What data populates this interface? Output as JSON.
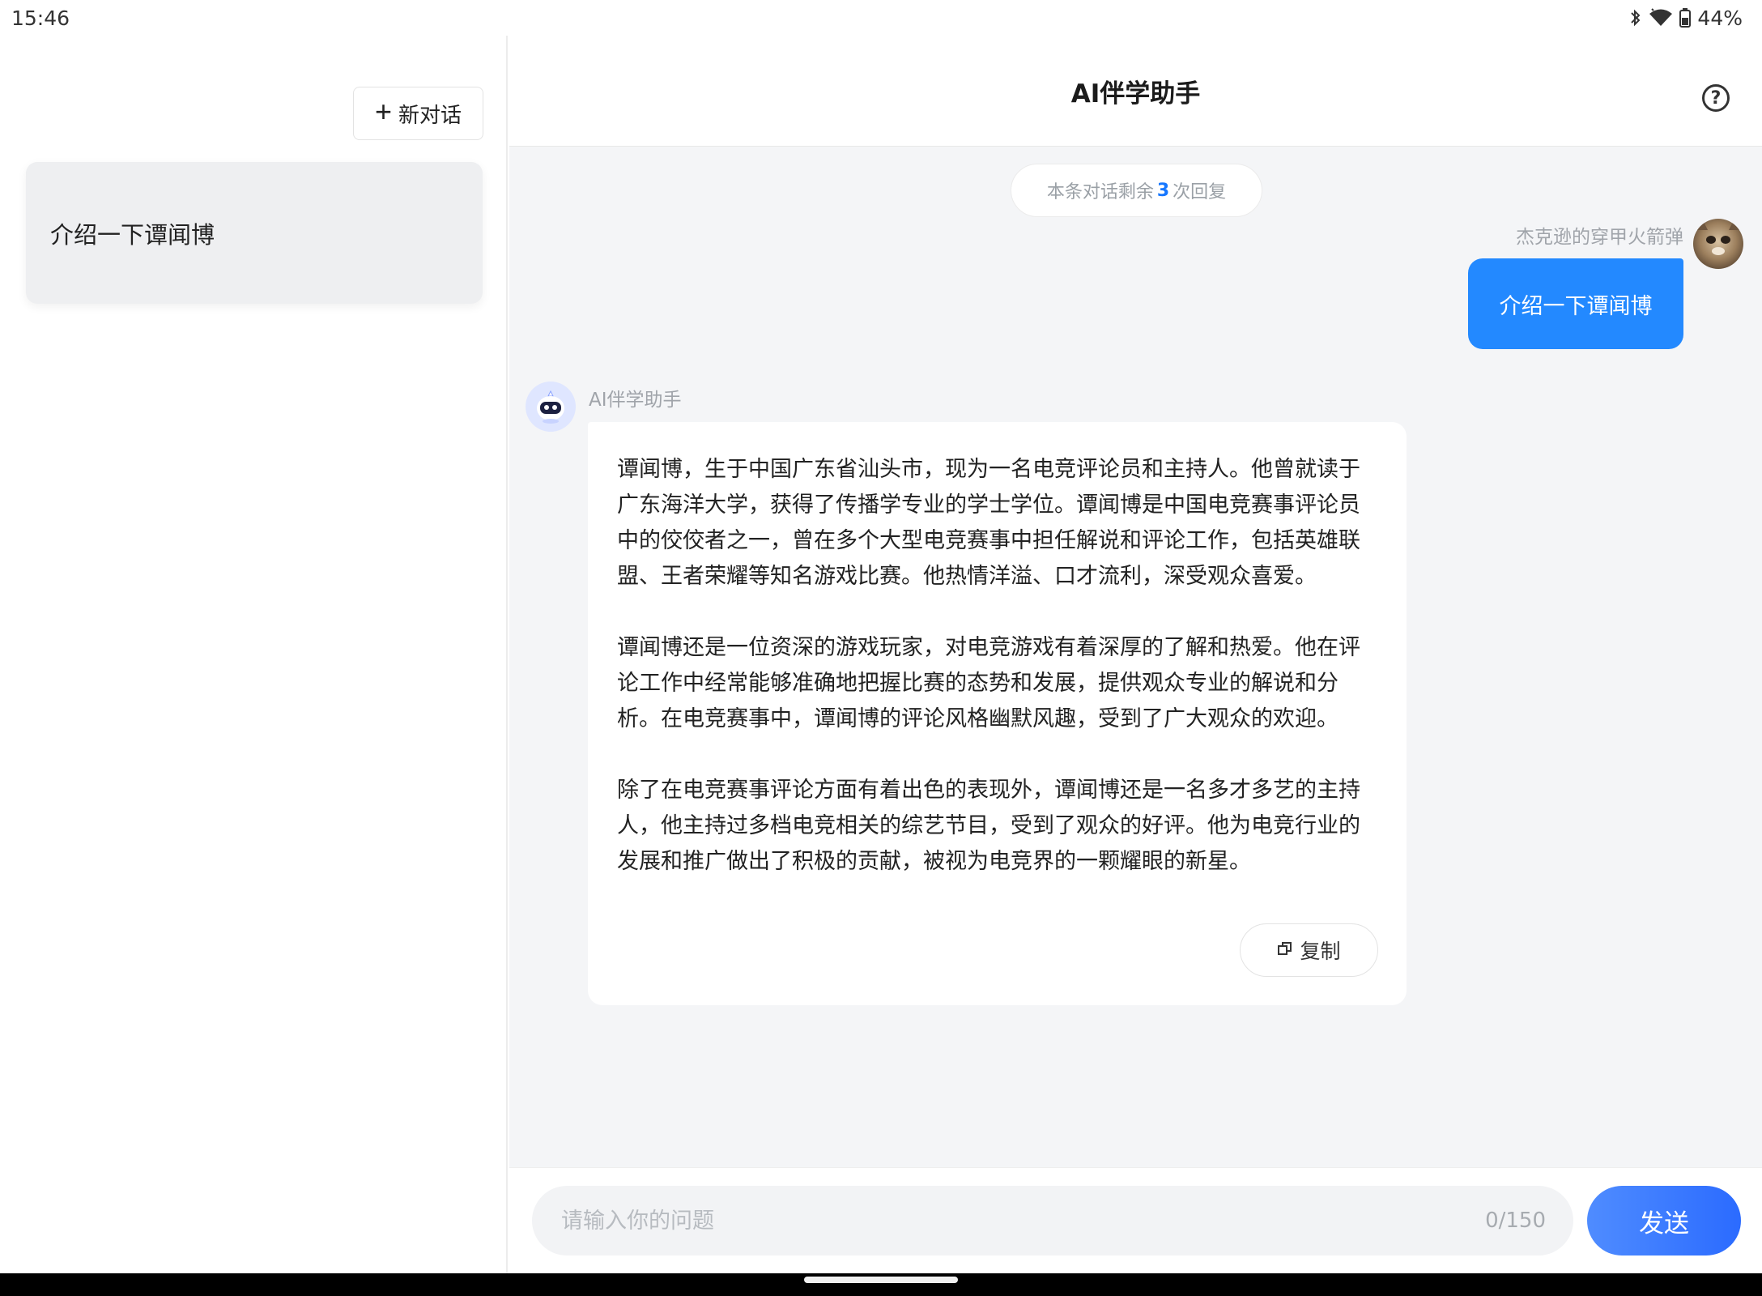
{
  "status_bar": {
    "time": "15:46",
    "battery": "44%",
    "icons": [
      "bluetooth-icon",
      "wifi-icon",
      "battery-icon"
    ]
  },
  "sidebar": {
    "new_chat_label": "新对话",
    "conversations": [
      {
        "title": "介绍一下谭闻博"
      }
    ]
  },
  "header": {
    "title": "AI伴学助手"
  },
  "chat": {
    "remaining": {
      "prefix": "本条对话剩余",
      "count": "3",
      "suffix": "次回复"
    },
    "user": {
      "name": "杰克逊的穿甲火箭弹",
      "message": "介绍一下谭闻博"
    },
    "assistant": {
      "name": "AI伴学助手",
      "paragraphs": [
        "谭闻博，生于中国广东省汕头市，现为一名电竞评论员和主持人。他曾就读于广东海洋大学，获得了传播学专业的学士学位。谭闻博是中国电竞赛事评论员中的佼佼者之一，曾在多个大型电竞赛事中担任解说和评论工作，包括英雄联盟、王者荣耀等知名游戏比赛。他热情洋溢、口才流利，深受观众喜爱。",
        "谭闻博还是一位资深的游戏玩家，对电竞游戏有着深厚的了解和热爱。他在评论工作中经常能够准确地把握比赛的态势和发展，提供观众专业的解说和分析。在电竞赛事中，谭闻博的评论风格幽默风趣，受到了广大观众的欢迎。",
        "除了在电竞赛事评论方面有着出色的表现外，谭闻博还是一名多才多艺的主持人，他主持过多档电竞相关的综艺节目，受到了观众的好评。他为电竞行业的发展和推广做出了积极的贡献，被视为电竞界的一颗耀眼的新星。"
      ],
      "copy_label": "复制"
    }
  },
  "input": {
    "placeholder": "请输入你的问题",
    "value": "",
    "counter": "0/150",
    "send_label": "发送"
  },
  "colors": {
    "accent": "#2389ff",
    "send_gradient_start": "#4f8cff",
    "send_gradient_end": "#2b6bff",
    "muted_text": "#a0a4aa"
  }
}
